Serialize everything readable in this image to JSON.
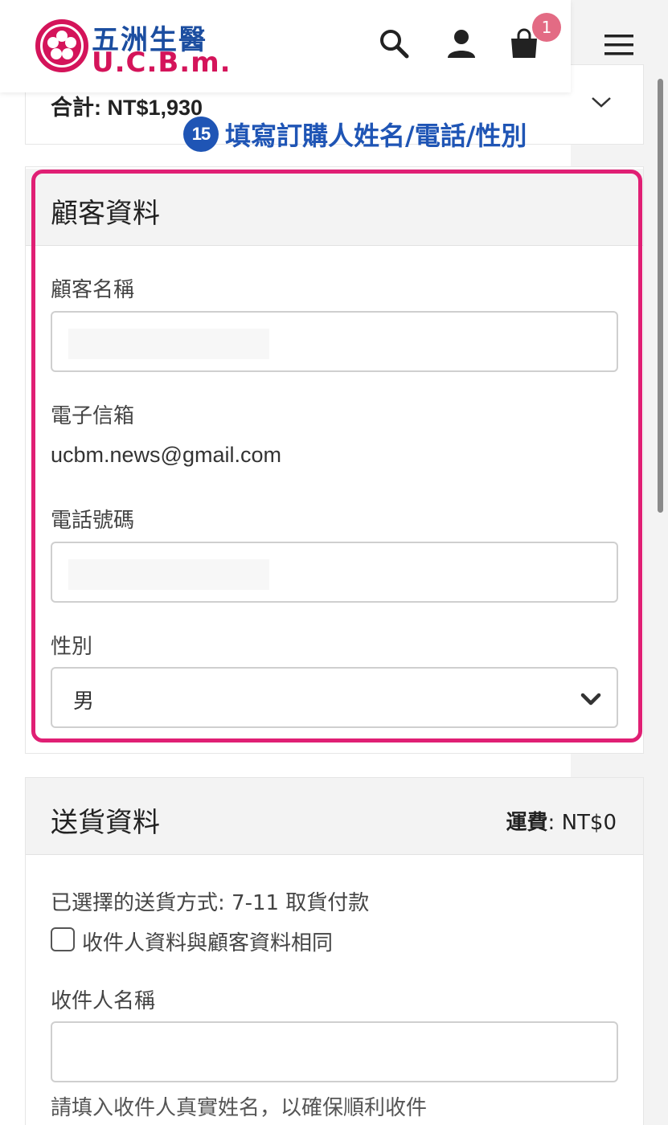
{
  "header": {
    "logo_cn": "五洲生醫",
    "logo_en": "U.C.B.m.",
    "cart_count": "1"
  },
  "summary": {
    "total_label": "合計: NT$1,930"
  },
  "annotation": {
    "number": "15",
    "text": "填寫訂購人姓名/電話/性別"
  },
  "customer": {
    "title": "顧客資料",
    "name_label": "顧客名稱",
    "name_value": "",
    "email_label": "電子信箱",
    "email_value": "ucbm.news@gmail.com",
    "phone_label": "電話號碼",
    "phone_value": "",
    "gender_label": "性別",
    "gender_value": "男"
  },
  "shipping": {
    "title": "送貨資料",
    "fee_label": "運費",
    "fee_value": ": NT$0",
    "method_text": "已選擇的送貨方式: 7-11 取貨付款",
    "same_as_customer_label": "收件人資料與顧客資料相同",
    "recipient_label": "收件人名稱",
    "recipient_value": "",
    "recipient_hint": "請填入收件人真實姓名，以確保順利收件"
  },
  "colors": {
    "brand_blue": "#1c4ea0",
    "brand_pink": "#d4145a",
    "highlight": "#e01f74",
    "annotation_blue": "#1f55b5",
    "badge": "#e36b84"
  }
}
